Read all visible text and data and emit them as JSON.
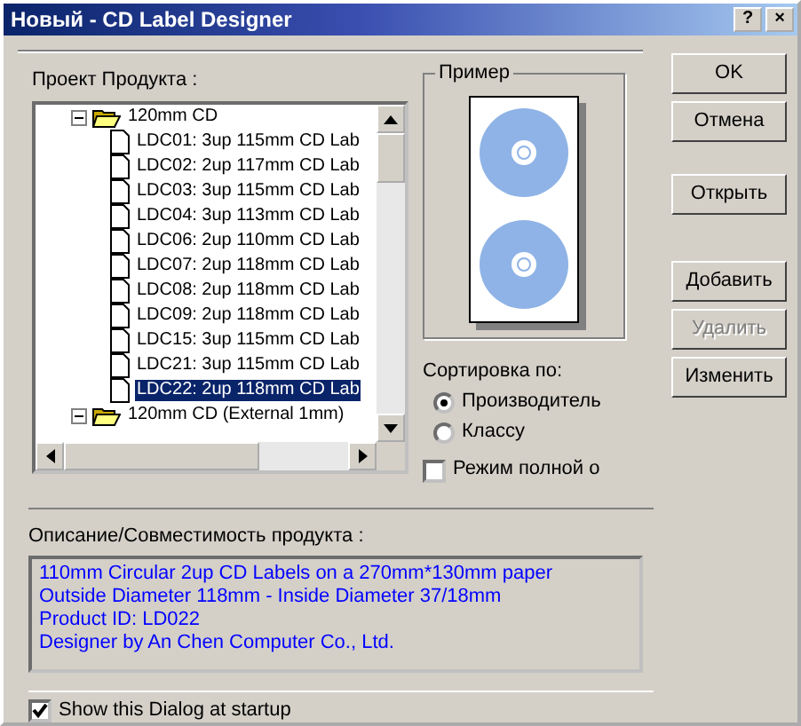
{
  "window": {
    "title": "Новый - CD Label Designer",
    "buttons": [
      "?",
      "×"
    ]
  },
  "tree": {
    "label": "Проект Продукта :",
    "items": [
      {
        "label": "120mm CD",
        "expanded": true,
        "children": [
          {
            "label": "LDC01: 3up 115mm CD Lab",
            "selected": false
          },
          {
            "label": "LDC02: 2up 117mm CD Lab",
            "selected": false
          },
          {
            "label": "LDC03: 3up 115mm CD Lab",
            "selected": false
          },
          {
            "label": "LDC04: 3up 113mm CD Lab",
            "selected": false
          },
          {
            "label": "LDC06: 2up 110mm CD Lab",
            "selected": false
          },
          {
            "label": "LDC07: 2up 118mm CD Lab",
            "selected": false
          },
          {
            "label": "LDC08: 2up 118mm CD Lab",
            "selected": false
          },
          {
            "label": "LDC09: 2up 118mm CD Lab",
            "selected": false
          },
          {
            "label": "LDC15: 3up 115mm CD Lab",
            "selected": false
          },
          {
            "label": "LDC21: 3up 115mm CD Lab",
            "selected": false
          },
          {
            "label": "LDC22: 2up 118mm CD Lab",
            "selected": true
          }
        ]
      },
      {
        "label": "120mm CD (External 1mm)",
        "expanded": true
      }
    ]
  },
  "preview": {
    "title": "Пример"
  },
  "sort": {
    "label": "Сортировка по:",
    "options": [
      {
        "label": "Производитель",
        "selected": true
      },
      {
        "label": "Классу",
        "selected": false
      }
    ]
  },
  "full_mode": {
    "label": "Режим полной о",
    "checked": false
  },
  "buttons": [
    {
      "label": "OK",
      "disabled": false
    },
    {
      "label": "Отмена",
      "disabled": false
    },
    {
      "label": "Открыть",
      "disabled": false
    },
    {
      "label": "Добавить",
      "disabled": false
    },
    {
      "label": "Удалить",
      "disabled": true
    },
    {
      "label": "Изменить",
      "disabled": false
    }
  ],
  "description": {
    "label": "Описание/Совместимость продукта :",
    "lines": [
      "110mm Circular 2up CD Labels on a 270mm*130mm paper",
      "Outside Diameter 118mm - Inside Diameter 37/18mm",
      "Product ID: LD022",
      "Designer by An Chen Computer Co., Ltd."
    ]
  },
  "startup": {
    "label": "Show this Dialog at startup",
    "checked": true
  }
}
